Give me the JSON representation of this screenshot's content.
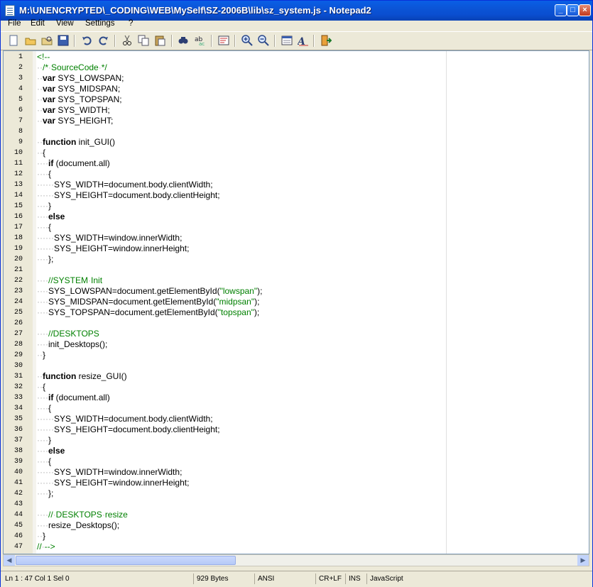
{
  "window": {
    "title": "M:\\UNENCRYPTED\\_CODING\\WEB\\MySelf\\SZ-2006B\\lib\\sz_system.js - Notepad2"
  },
  "menu": [
    {
      "label": "File"
    },
    {
      "label": "Edit"
    },
    {
      "label": "View"
    },
    {
      "label": "Settings"
    },
    {
      "label": "?"
    }
  ],
  "toolbar": [
    {
      "name": "new-icon"
    },
    {
      "name": "open-icon"
    },
    {
      "name": "browse-icon"
    },
    {
      "name": "save-icon"
    },
    {
      "name": "undo-icon"
    },
    {
      "name": "redo-icon"
    },
    {
      "name": "cut-icon"
    },
    {
      "name": "copy-icon"
    },
    {
      "name": "paste-icon"
    },
    {
      "name": "find-icon"
    },
    {
      "name": "replace-icon"
    },
    {
      "name": "wordwrap-icon"
    },
    {
      "name": "zoom-in-icon"
    },
    {
      "name": "zoom-out-icon"
    },
    {
      "name": "scheme-icon"
    },
    {
      "name": "font-icon"
    },
    {
      "name": "exit-icon"
    }
  ],
  "editor": {
    "lines": [
      "<!--",
      "  /* SourceCode */",
      "  var SYS_LOWSPAN;",
      "  var SYS_MIDSPAN;",
      "  var SYS_TOPSPAN;",
      "  var SYS_WIDTH;",
      "  var SYS_HEIGHT;",
      "",
      "  function init_GUI()",
      "  {",
      "    if (document.all)",
      "    {",
      "      SYS_WIDTH=document.body.clientWidth;",
      "      SYS_HEIGHT=document.body.clientHeight;",
      "    }",
      "    else",
      "    {",
      "      SYS_WIDTH=window.innerWidth;",
      "      SYS_HEIGHT=window.innerHeight;",
      "    };",
      "",
      "    //SYSTEM Init",
      "    SYS_LOWSPAN=document.getElementById(\"lowspan\");",
      "    SYS_MIDSPAN=document.getElementById(\"midpsan\");",
      "    SYS_TOPSPAN=document.getElementById(\"topspan\");",
      "",
      "    //DESKTOPS",
      "    init_Desktops();",
      "  }",
      "",
      "  function resize_GUI()",
      "  {",
      "    if (document.all)",
      "    {",
      "      SYS_WIDTH=document.body.clientWidth;",
      "      SYS_HEIGHT=document.body.clientHeight;",
      "    }",
      "    else",
      "    {",
      "      SYS_WIDTH=window.innerWidth;",
      "      SYS_HEIGHT=window.innerHeight;",
      "    };",
      "",
      "    // DESKTOPS resize",
      "    resize_Desktops();",
      "  }",
      "// -->"
    ]
  },
  "status": {
    "position": "Ln 1 : 47   Col 1   Sel 0",
    "size": "929 Bytes",
    "encoding": "ANSI",
    "line_endings": "CR+LF",
    "mode": "INS",
    "language": "JavaScript"
  },
  "colors": {
    "titlebar": "#0a54d6",
    "comment": "#008000",
    "string": "#008000",
    "keyword": "#000000"
  }
}
